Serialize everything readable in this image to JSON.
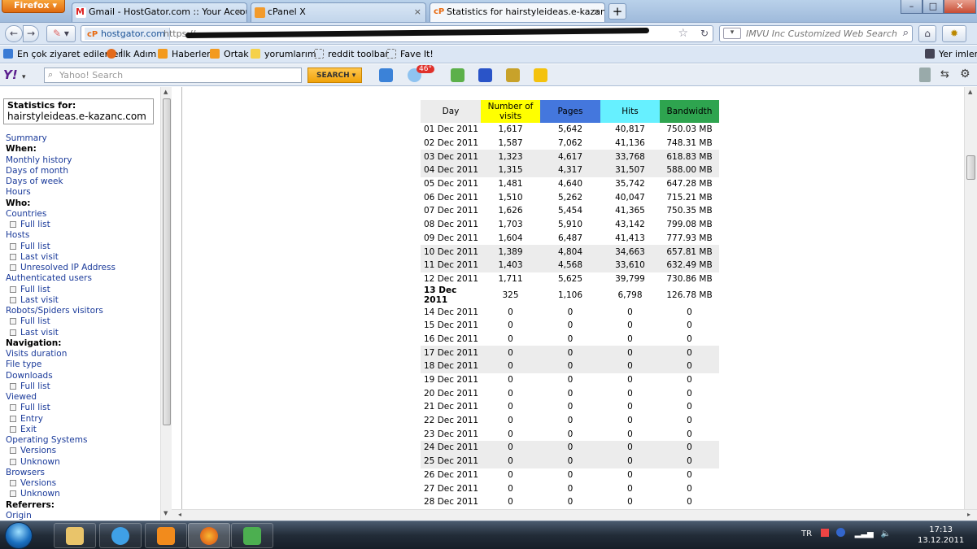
{
  "browser": {
    "app_button": "Firefox",
    "tabs": [
      {
        "label": "Gmail - HostGator.com :: Your Accou...",
        "close": "×"
      },
      {
        "label": "cPanel X",
        "close": "×"
      },
      {
        "label": "Statistics for hairstyleideas.e-kazanc.c...",
        "close": "×"
      }
    ],
    "new_tab": "+",
    "window_controls": {
      "minimize": "–",
      "maximize": "□",
      "close": "✕"
    },
    "url_site": "hostgator.com",
    "url_site_badge": "cP",
    "url_text": "https://",
    "search_placeholder": "IMVU Inc Customized Web Search",
    "bookmarks": [
      {
        "label": "En çok ziyaret edilenler"
      },
      {
        "label": "İlk Adım"
      },
      {
        "label": "Haberler"
      },
      {
        "label": "Ortak"
      },
      {
        "label": "yorumlarım"
      },
      {
        "label": "reddit toolbar"
      },
      {
        "label": "Fave It!"
      }
    ],
    "bookmarks_right": "Yer imleri",
    "yahoo": {
      "search_placeholder": "Yahoo! Search",
      "search_button": "SEARCH",
      "weather_badge": "46°"
    }
  },
  "sidebar": {
    "stats_for_label": "Statistics for:",
    "stats_for_host": "hairstyleideas.e-kazanc.com",
    "menu": [
      {
        "label": "Summary",
        "type": "link"
      },
      {
        "label": "When:",
        "type": "heading"
      },
      {
        "label": "Monthly history",
        "type": "link"
      },
      {
        "label": "Days of month",
        "type": "link"
      },
      {
        "label": "Days of week",
        "type": "link"
      },
      {
        "label": "Hours",
        "type": "link"
      },
      {
        "label": "Who:",
        "type": "heading"
      },
      {
        "label": "Countries",
        "type": "link"
      },
      {
        "label": "Full list",
        "type": "sub"
      },
      {
        "label": "Hosts",
        "type": "link"
      },
      {
        "label": "Full list",
        "type": "sub"
      },
      {
        "label": "Last visit",
        "type": "sub"
      },
      {
        "label": "Unresolved IP Address",
        "type": "sub"
      },
      {
        "label": "Authenticated users",
        "type": "link"
      },
      {
        "label": "Full list",
        "type": "sub"
      },
      {
        "label": "Last visit",
        "type": "sub"
      },
      {
        "label": "Robots/Spiders visitors",
        "type": "link"
      },
      {
        "label": "Full list",
        "type": "sub"
      },
      {
        "label": "Last visit",
        "type": "sub"
      },
      {
        "label": "Navigation:",
        "type": "heading"
      },
      {
        "label": "Visits duration",
        "type": "link"
      },
      {
        "label": "File type",
        "type": "link"
      },
      {
        "label": "Downloads",
        "type": "link"
      },
      {
        "label": "Full list",
        "type": "sub"
      },
      {
        "label": "Viewed",
        "type": "link"
      },
      {
        "label": "Full list",
        "type": "sub"
      },
      {
        "label": "Entry",
        "type": "sub"
      },
      {
        "label": "Exit",
        "type": "sub"
      },
      {
        "label": "Operating Systems",
        "type": "link"
      },
      {
        "label": "Versions",
        "type": "sub"
      },
      {
        "label": "Unknown",
        "type": "sub"
      },
      {
        "label": "Browsers",
        "type": "link"
      },
      {
        "label": "Versions",
        "type": "sub"
      },
      {
        "label": "Unknown",
        "type": "sub"
      },
      {
        "label": "Referrers:",
        "type": "heading"
      },
      {
        "label": "Origin",
        "type": "link"
      }
    ]
  },
  "table": {
    "headers": [
      {
        "label": "Day",
        "color": "#ececec"
      },
      {
        "label": "Number of visits",
        "color": "#ffff00"
      },
      {
        "label": "Pages",
        "color": "#4477dd"
      },
      {
        "label": "Hits",
        "color": "#66f0ff"
      },
      {
        "label": "Bandwidth",
        "color": "#2ea44f"
      }
    ],
    "rows": [
      {
        "day": "01 Dec 2011",
        "visits": "1,617",
        "pages": "5,642",
        "hits": "40,817",
        "bw": "750.03 MB",
        "alt": false,
        "bold": false
      },
      {
        "day": "02 Dec 2011",
        "visits": "1,587",
        "pages": "7,062",
        "hits": "41,136",
        "bw": "748.31 MB",
        "alt": false,
        "bold": false
      },
      {
        "day": "03 Dec 2011",
        "visits": "1,323",
        "pages": "4,617",
        "hits": "33,768",
        "bw": "618.83 MB",
        "alt": true,
        "bold": false
      },
      {
        "day": "04 Dec 2011",
        "visits": "1,315",
        "pages": "4,317",
        "hits": "31,507",
        "bw": "588.00 MB",
        "alt": true,
        "bold": false
      },
      {
        "day": "05 Dec 2011",
        "visits": "1,481",
        "pages": "4,640",
        "hits": "35,742",
        "bw": "647.28 MB",
        "alt": false,
        "bold": false
      },
      {
        "day": "06 Dec 2011",
        "visits": "1,510",
        "pages": "5,262",
        "hits": "40,047",
        "bw": "715.21 MB",
        "alt": false,
        "bold": false
      },
      {
        "day": "07 Dec 2011",
        "visits": "1,626",
        "pages": "5,454",
        "hits": "41,365",
        "bw": "750.35 MB",
        "alt": false,
        "bold": false
      },
      {
        "day": "08 Dec 2011",
        "visits": "1,703",
        "pages": "5,910",
        "hits": "43,142",
        "bw": "799.08 MB",
        "alt": false,
        "bold": false
      },
      {
        "day": "09 Dec 2011",
        "visits": "1,604",
        "pages": "6,487",
        "hits": "41,413",
        "bw": "777.93 MB",
        "alt": false,
        "bold": false
      },
      {
        "day": "10 Dec 2011",
        "visits": "1,389",
        "pages": "4,804",
        "hits": "34,663",
        "bw": "657.81 MB",
        "alt": true,
        "bold": false
      },
      {
        "day": "11 Dec 2011",
        "visits": "1,403",
        "pages": "4,568",
        "hits": "33,610",
        "bw": "632.49 MB",
        "alt": true,
        "bold": false
      },
      {
        "day": "12 Dec 2011",
        "visits": "1,711",
        "pages": "5,625",
        "hits": "39,799",
        "bw": "730.86 MB",
        "alt": false,
        "bold": false
      },
      {
        "day": "13 Dec 2011",
        "visits": "325",
        "pages": "1,106",
        "hits": "6,798",
        "bw": "126.78 MB",
        "alt": false,
        "bold": true
      },
      {
        "day": "14 Dec 2011",
        "visits": "0",
        "pages": "0",
        "hits": "0",
        "bw": "0",
        "alt": false,
        "bold": false
      },
      {
        "day": "15 Dec 2011",
        "visits": "0",
        "pages": "0",
        "hits": "0",
        "bw": "0",
        "alt": false,
        "bold": false
      },
      {
        "day": "16 Dec 2011",
        "visits": "0",
        "pages": "0",
        "hits": "0",
        "bw": "0",
        "alt": false,
        "bold": false
      },
      {
        "day": "17 Dec 2011",
        "visits": "0",
        "pages": "0",
        "hits": "0",
        "bw": "0",
        "alt": true,
        "bold": false
      },
      {
        "day": "18 Dec 2011",
        "visits": "0",
        "pages": "0",
        "hits": "0",
        "bw": "0",
        "alt": true,
        "bold": false
      },
      {
        "day": "19 Dec 2011",
        "visits": "0",
        "pages": "0",
        "hits": "0",
        "bw": "0",
        "alt": false,
        "bold": false
      },
      {
        "day": "20 Dec 2011",
        "visits": "0",
        "pages": "0",
        "hits": "0",
        "bw": "0",
        "alt": false,
        "bold": false
      },
      {
        "day": "21 Dec 2011",
        "visits": "0",
        "pages": "0",
        "hits": "0",
        "bw": "0",
        "alt": false,
        "bold": false
      },
      {
        "day": "22 Dec 2011",
        "visits": "0",
        "pages": "0",
        "hits": "0",
        "bw": "0",
        "alt": false,
        "bold": false
      },
      {
        "day": "23 Dec 2011",
        "visits": "0",
        "pages": "0",
        "hits": "0",
        "bw": "0",
        "alt": false,
        "bold": false
      },
      {
        "day": "24 Dec 2011",
        "visits": "0",
        "pages": "0",
        "hits": "0",
        "bw": "0",
        "alt": true,
        "bold": false
      },
      {
        "day": "25 Dec 2011",
        "visits": "0",
        "pages": "0",
        "hits": "0",
        "bw": "0",
        "alt": true,
        "bold": false
      },
      {
        "day": "26 Dec 2011",
        "visits": "0",
        "pages": "0",
        "hits": "0",
        "bw": "0",
        "alt": false,
        "bold": false
      },
      {
        "day": "27 Dec 2011",
        "visits": "0",
        "pages": "0",
        "hits": "0",
        "bw": "0",
        "alt": false,
        "bold": false
      },
      {
        "day": "28 Dec 2011",
        "visits": "0",
        "pages": "0",
        "hits": "0",
        "bw": "0",
        "alt": false,
        "bold": false
      }
    ]
  },
  "taskbar": {
    "lang": "TR",
    "time": "17:13",
    "date": "13.12.2011"
  }
}
